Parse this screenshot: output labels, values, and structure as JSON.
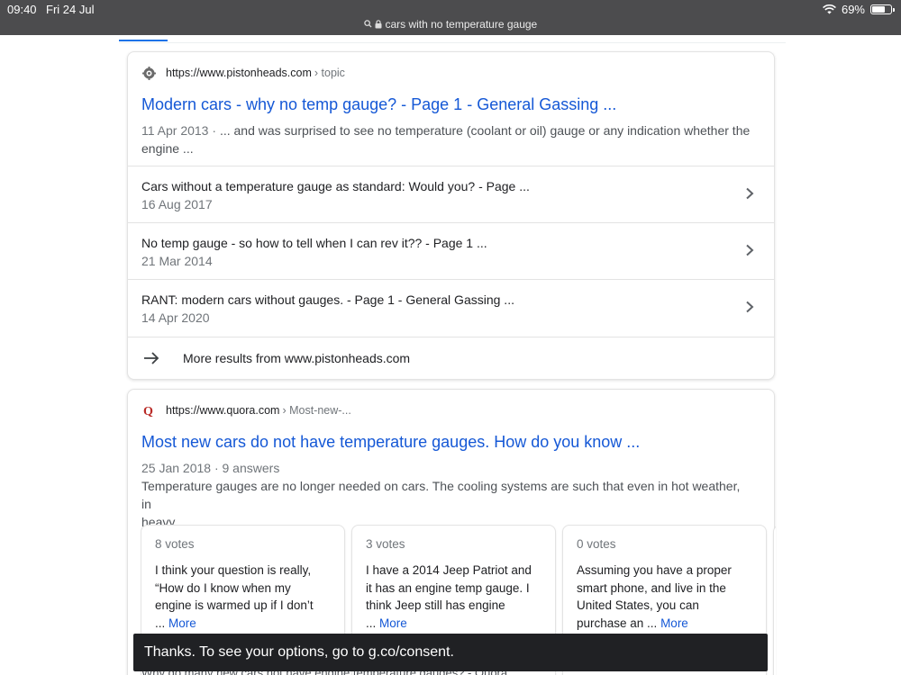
{
  "status": {
    "time": "09:40",
    "date": "Fri 24 Jul",
    "battery": "69%",
    "battery_level": 0.69,
    "url": "cars with no temperature gauge"
  },
  "result1": {
    "source_url": "https://www.pistonheads.com",
    "breadcrumb": "› topic",
    "icon": "pistonheads-favicon",
    "title": "Modern cars - why no temp gauge? - Page 1 - General Gassing ...",
    "snippet_date": "11 Apr 2013",
    "snippet_sep": " · ",
    "snippet_line1": "... and was surprised to see no temperature (coolant or oil) gauge or any indication whether the",
    "snippet_line2": "engine ...",
    "sublinks": [
      {
        "title": "Cars without a temperature gauge as standard: Would you? - Page ...",
        "date": "16 Aug 2017"
      },
      {
        "title": "No temp gauge - so how to tell when I can rev it?? - Page 1 ...",
        "date": "21 Mar 2014"
      },
      {
        "title": "RANT: modern cars without gauges. - Page 1 - General Gassing ...",
        "date": "14 Apr 2020"
      }
    ],
    "more_results": "More results from www.pistonheads.com"
  },
  "result2": {
    "source_url": "https://www.quora.com",
    "breadcrumb": "› Most-new-...",
    "icon": "quora-favicon",
    "title": "Most new cars do not have temperature gauges. How do you know ...",
    "meta": "25 Jan 2018 · 9 answers",
    "snippet_line1": "Temperature gauges are no longer needed on cars. The cooling systems are such that even in hot weather, in",
    "snippet_line2": "heavy ...",
    "answers": [
      {
        "votes": "8 votes",
        "l1": "I think your question is really,",
        "l2": "“How do I know when my",
        "l3": "engine is warmed up if I don’t",
        "l4": "... ",
        "more": "More"
      },
      {
        "votes": "3 votes",
        "l1": "I have a 2014 Jeep Patriot and",
        "l2": "it has an engine temp gauge. I",
        "l3": "think Jeep still has engine",
        "l4": "... ",
        "more": "More"
      },
      {
        "votes": "0 votes",
        "l1": "Assuming you have a proper",
        "l2": "smart phone, and live in the",
        "l3": "United States, you can",
        "l4": "purchase an ... ",
        "more": "More"
      }
    ]
  },
  "consent_banner": "Thanks. To see your options, go to g.co/consent.",
  "peek_text": "Why do many new cars not have engine temperature gauges? - Quora"
}
